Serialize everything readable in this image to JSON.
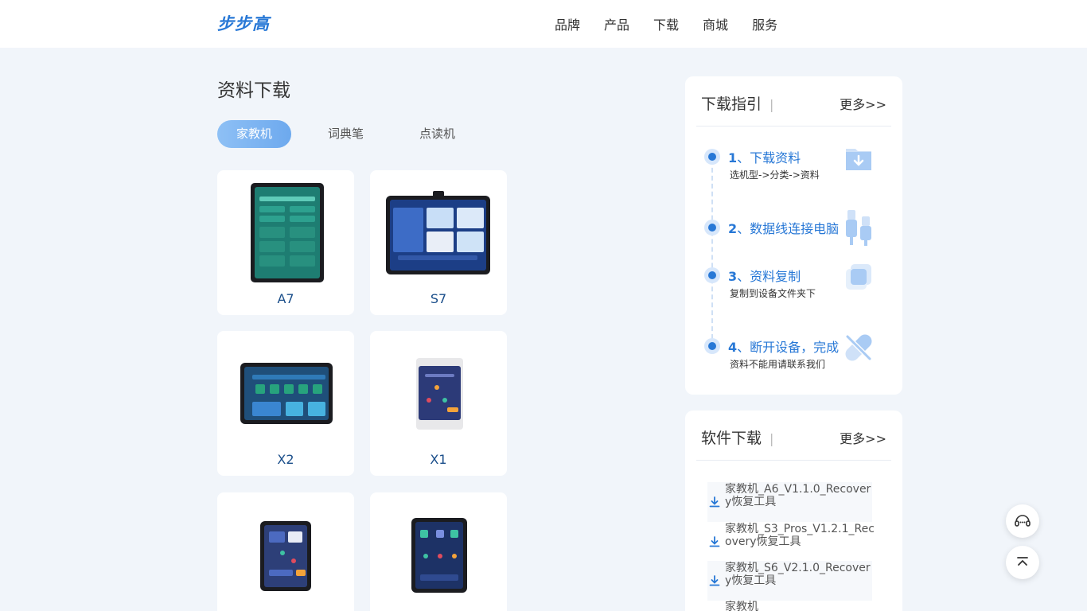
{
  "brand": {
    "logo_text": "步步高"
  },
  "nav": [
    "品牌",
    "产品",
    "下载",
    "商城",
    "服务"
  ],
  "page": {
    "title": "资料下载"
  },
  "tabs": [
    {
      "label": "家教机",
      "active": true
    },
    {
      "label": "词典笔",
      "active": false
    },
    {
      "label": "点读机",
      "active": false
    }
  ],
  "products": [
    "A7",
    "S7",
    "X2",
    "X1",
    "",
    ""
  ],
  "guide": {
    "title": "下载指引",
    "more": "更多>>",
    "steps": [
      {
        "num": "1",
        "title": "、下载资料",
        "sub": "选机型->分类->资料",
        "icon": "download-folder-icon"
      },
      {
        "num": "2",
        "title": "、数据线连接电脑",
        "sub": "",
        "icon": "usb-cable-icon"
      },
      {
        "num": "3",
        "title": "、资料复制",
        "sub": "复制到设备文件夹下",
        "icon": "copy-icon"
      },
      {
        "num": "4",
        "title": "、断开设备，完成",
        "sub": "资料不能用请联系我们",
        "icon": "disconnect-icon"
      }
    ]
  },
  "software": {
    "title": "软件下载",
    "more": "更多>>",
    "items": [
      "家教机_A6_V1.1.0_Recovery恢复工具",
      "家教机_S3_Pros_V1.2.1_Recovery恢复工具",
      "家教机_S6_V2.1.0_Recovery恢复工具",
      "家教机"
    ]
  },
  "colors": {
    "accent": "#2878d6",
    "background": "#f1f5fa"
  },
  "floating": {
    "chat_icon": "customer-service-icon",
    "top_icon": "back-to-top-icon"
  }
}
